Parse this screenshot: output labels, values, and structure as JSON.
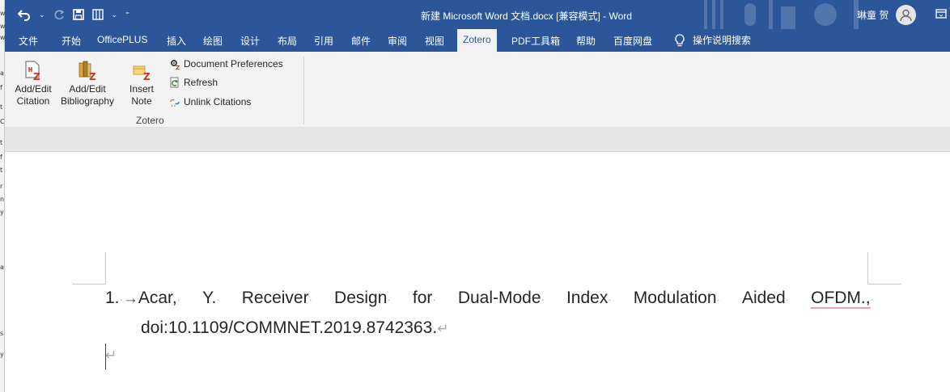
{
  "window": {
    "title": "新建 Microsoft Word 文档.docx [兼容模式] - Word",
    "user_name": "琳童 贺"
  },
  "quick_access": {
    "undo_icon": "undo-icon",
    "redo_icon": "redo-icon",
    "save_icon": "save-icon",
    "layout_icon": "layout-icon"
  },
  "tabs": [
    {
      "label": "文件"
    },
    {
      "label": "开始"
    },
    {
      "label": "OfficePLUS"
    },
    {
      "label": "插入"
    },
    {
      "label": "绘图"
    },
    {
      "label": "设计"
    },
    {
      "label": "布局"
    },
    {
      "label": "引用"
    },
    {
      "label": "邮件"
    },
    {
      "label": "审阅"
    },
    {
      "label": "视图"
    },
    {
      "label": "Zotero"
    },
    {
      "label": "PDF工具箱"
    },
    {
      "label": "帮助"
    },
    {
      "label": "百度网盘"
    }
  ],
  "active_tab": "Zotero",
  "tell_me": "操作说明搜索",
  "ribbon": {
    "add_edit_citation": {
      "line1": "Add/Edit",
      "line2": "Citation"
    },
    "add_edit_bibliography": {
      "line1": "Add/Edit",
      "line2": "Bibliography"
    },
    "insert_note": {
      "line1": "Insert",
      "line2": "Note"
    },
    "document_preferences": "Document Preferences",
    "refresh": "Refresh",
    "unlink_citations": "Unlink Citations",
    "group_label": "Zotero"
  },
  "document": {
    "entry_number": "1.",
    "words": [
      "Acar,",
      "Y.",
      "Receiver",
      "Design",
      "for",
      "Dual-Mode",
      "Index",
      "Modulation",
      "Aided",
      "OFDM.,"
    ],
    "line2": "doi:10.1109/COMMNET.2019.8742363.",
    "space_mark": "·",
    "tab_mark": "→",
    "paragraph_mark": "↵"
  },
  "left_strip_letters": [
    "w",
    "w",
    "w",
    "a",
    "f",
    "t",
    "C",
    "t",
    "f",
    "t",
    "r",
    "n",
    "y",
    "a",
    "s",
    "y"
  ],
  "colors": {
    "word_blue": "#2b579a",
    "ribbon_bg": "#f3f3f3",
    "spell_underline": "#e8a2b6"
  }
}
